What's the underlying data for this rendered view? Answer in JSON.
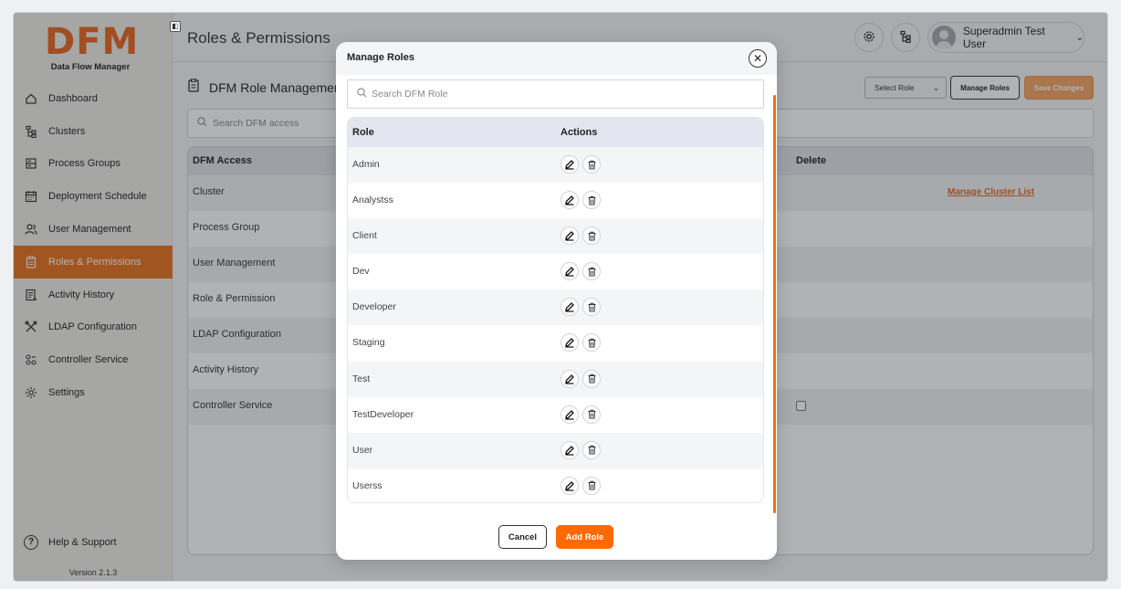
{
  "brand": {
    "logo_text": "DFM",
    "subtitle": "Data Flow Manager",
    "accent": "#e8721e"
  },
  "sidebar": {
    "items": [
      {
        "label": "Dashboard",
        "icon": "home-icon",
        "active": false
      },
      {
        "label": "Clusters",
        "icon": "cluster-icon",
        "active": false
      },
      {
        "label": "Process Groups",
        "icon": "process-groups-icon",
        "active": false
      },
      {
        "label": "Deployment Schedule",
        "icon": "calendar-icon",
        "active": false
      },
      {
        "label": "User Management",
        "icon": "users-icon",
        "active": false
      },
      {
        "label": "Roles & Permissions",
        "icon": "clipboard-icon",
        "active": true
      },
      {
        "label": "Activity History",
        "icon": "history-icon",
        "active": false
      },
      {
        "label": "LDAP Configuration",
        "icon": "tools-icon",
        "active": false
      },
      {
        "label": "Controller Service",
        "icon": "controller-icon",
        "active": false
      },
      {
        "label": "Settings",
        "icon": "gear-icon",
        "active": false
      }
    ],
    "help_label": "Help & Support",
    "version": "Version 2.1.3"
  },
  "header": {
    "title": "Roles & Permissions",
    "user_name": "Superadmin Test User"
  },
  "content": {
    "section_title": "DFM Role Management",
    "select_role": "Select Role",
    "manage_roles_label": "Manage Roles",
    "save_changes_label": "Save Changes",
    "search_placeholder": "Search DFM access",
    "columns": {
      "access": "DFM Access",
      "delete": "Delete"
    },
    "rows": [
      "Cluster",
      "Process Group",
      "User Management",
      "Role & Permission",
      "LDAP Configuration",
      "Activity History",
      "Controller Service"
    ],
    "manage_cluster_link": "Manage Cluster List"
  },
  "modal": {
    "title": "Manage Roles",
    "search_placeholder": "Search DFM Role",
    "columns": {
      "role": "Role",
      "actions": "Actions"
    },
    "roles": [
      "Admin",
      "Analystss",
      "Client",
      "Dev",
      "Developer",
      "Staging",
      "Test",
      "TestDeveloper",
      "User",
      "Userss"
    ],
    "cancel_label": "Cancel",
    "add_label": "Add Role"
  }
}
